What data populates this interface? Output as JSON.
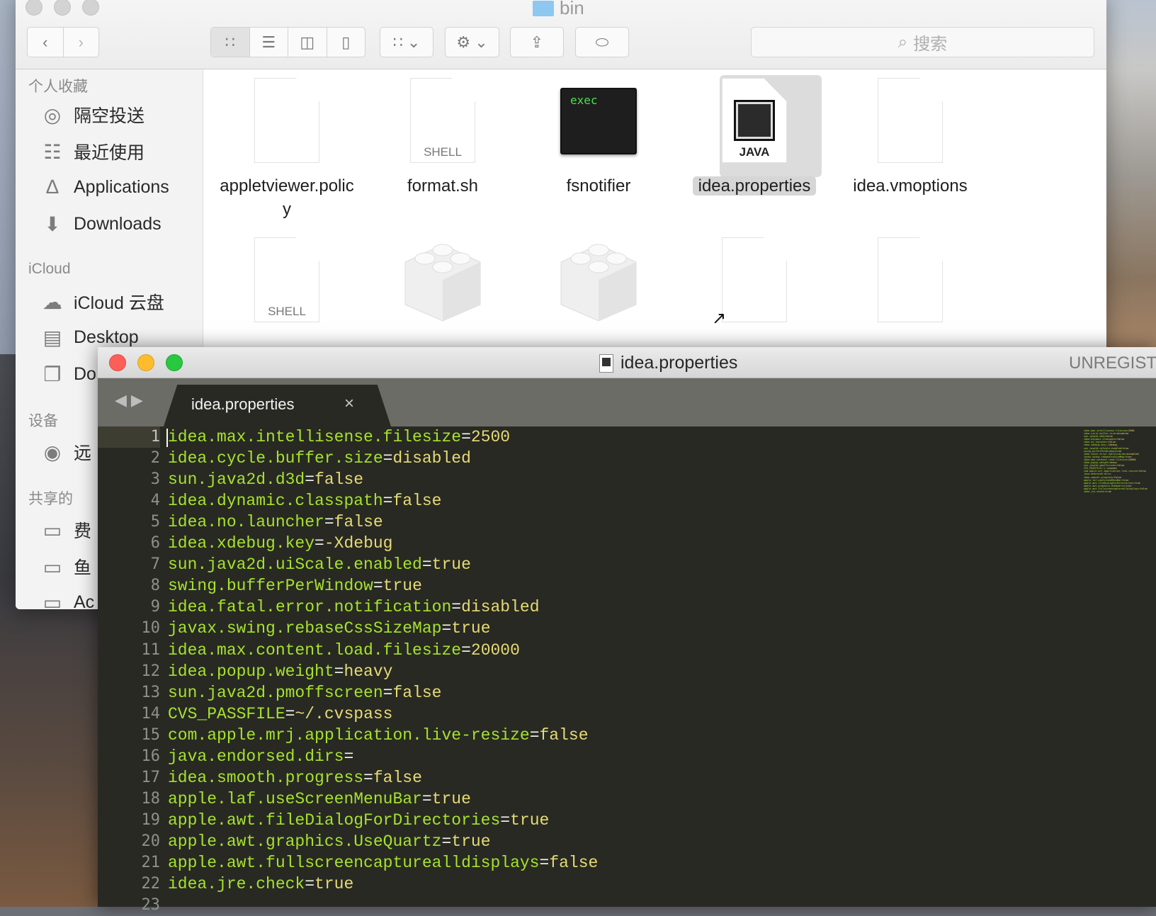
{
  "finder": {
    "title": "bin",
    "search_placeholder": "搜索",
    "sidebar": {
      "sections": [
        {
          "heading": "个人收藏",
          "items": [
            {
              "label": "隔空投送",
              "icon": "airdrop-icon"
            },
            {
              "label": "最近使用",
              "icon": "recents-icon"
            },
            {
              "label": "Applications",
              "icon": "applications-icon"
            },
            {
              "label": "Downloads",
              "icon": "downloads-icon"
            }
          ]
        },
        {
          "heading": "iCloud",
          "items": [
            {
              "label": "iCloud 云盘",
              "icon": "cloud-icon"
            },
            {
              "label": "Desktop",
              "icon": "desktop-icon"
            },
            {
              "label": "Do",
              "icon": "documents-icon"
            }
          ]
        },
        {
          "heading": "设备",
          "items": [
            {
              "label": "远",
              "icon": "disc-icon"
            }
          ]
        },
        {
          "heading": "共享的",
          "items": [
            {
              "label": "费",
              "icon": "computer-icon"
            },
            {
              "label": "鱼",
              "icon": "computer-icon"
            },
            {
              "label": "Ac",
              "icon": "computer-icon"
            }
          ]
        }
      ]
    },
    "files": [
      {
        "name": "appletviewer.policy",
        "name_lines": [
          "appletviewer.polic",
          "y"
        ],
        "kind": "document"
      },
      {
        "name": "format.sh",
        "kind": "shell",
        "badge": "SHELL"
      },
      {
        "name": "fsnotifier",
        "kind": "exec",
        "badge": "exec"
      },
      {
        "name": "idea.properties",
        "kind": "java",
        "badge": "JAVA",
        "selected": true
      },
      {
        "name": "idea.vmoptions",
        "kind": "document"
      },
      {
        "kind": "shell",
        "badge": "SHELL"
      },
      {
        "kind": "library"
      },
      {
        "kind": "library"
      },
      {
        "kind": "alias-document"
      },
      {
        "kind": "document"
      }
    ]
  },
  "editor": {
    "window_title": "idea.properties",
    "license_status": "UNREGISTERED",
    "tab": {
      "label": "idea.properties",
      "close": "×"
    },
    "colors": {
      "background": "#282923",
      "key": "#a6e22e",
      "value": "#e6db74",
      "operator": "#f8f8f2"
    },
    "lines": [
      {
        "n": "1",
        "key": "idea.max.intellisense.filesize",
        "value": "2500"
      },
      {
        "n": "2",
        "key": "idea.cycle.buffer.size",
        "value": "disabled"
      },
      {
        "n": "3",
        "key": "sun.java2d.d3d",
        "value": "false"
      },
      {
        "n": "4",
        "key": "idea.dynamic.classpath",
        "value": "false"
      },
      {
        "n": "5",
        "key": "idea.no.launcher",
        "value": "false"
      },
      {
        "n": "6",
        "key": "idea.xdebug.key",
        "value": "-Xdebug"
      },
      {
        "n": "7",
        "key": "sun.java2d.uiScale.enabled",
        "value": "true"
      },
      {
        "n": "8",
        "key": "swing.bufferPerWindow",
        "value": "true"
      },
      {
        "n": "9",
        "key": "idea.fatal.error.notification",
        "value": "disabled"
      },
      {
        "n": "10",
        "key": "javax.swing.rebaseCssSizeMap",
        "value": "true"
      },
      {
        "n": "11",
        "key": "idea.max.content.load.filesize",
        "value": "20000"
      },
      {
        "n": "12",
        "key": "idea.popup.weight",
        "value": "heavy"
      },
      {
        "n": "13",
        "key": "sun.java2d.pmoffscreen",
        "value": "false"
      },
      {
        "n": "14",
        "key": "CVS_PASSFILE",
        "value": "~/.cvspass"
      },
      {
        "n": "15",
        "key": "com.apple.mrj.application.live-resize",
        "value": "false"
      },
      {
        "n": "16",
        "key": "java.endorsed.dirs",
        "value": ""
      },
      {
        "n": "17",
        "key": "idea.smooth.progress",
        "value": "false"
      },
      {
        "n": "18",
        "key": "apple.laf.useScreenMenuBar",
        "value": "true"
      },
      {
        "n": "19",
        "key": "apple.awt.fileDialogForDirectories",
        "value": "true"
      },
      {
        "n": "20",
        "key": "apple.awt.graphics.UseQuartz",
        "value": "true"
      },
      {
        "n": "21",
        "key": "apple.awt.fullscreencapturealldisplays",
        "value": "false"
      },
      {
        "n": "22",
        "key": "idea.jre.check",
        "value": "true"
      },
      {
        "n": "23",
        "key": "",
        "value": ""
      }
    ]
  }
}
